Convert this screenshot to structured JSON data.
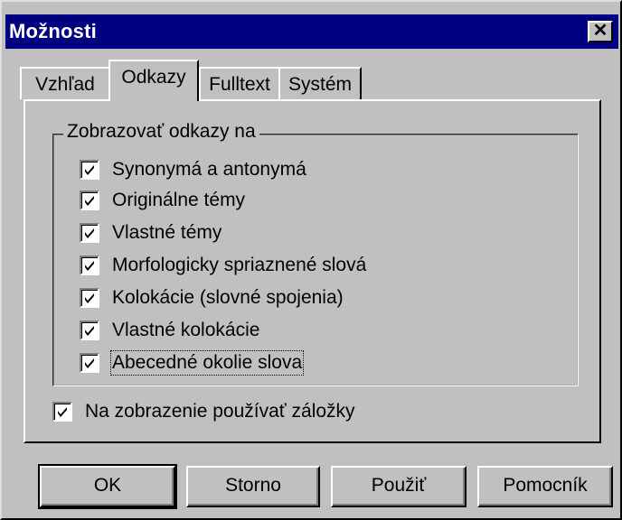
{
  "window": {
    "title": "Možnosti",
    "close_label": "✕"
  },
  "tabs": [
    {
      "label": "Vzhľad",
      "active": false
    },
    {
      "label": "Odkazy",
      "active": true
    },
    {
      "label": "Fulltext",
      "active": false
    },
    {
      "label": "Systém",
      "active": false
    }
  ],
  "group": {
    "legend": "Zobrazovať odkazy na",
    "items": [
      {
        "label": "Synonymá a antonymá",
        "checked": true
      },
      {
        "label": "Originálne témy",
        "checked": true
      },
      {
        "label": "Vlastné témy",
        "checked": true
      },
      {
        "label": "Morfologicky spriaznené slová",
        "checked": true
      },
      {
        "label": "Kolokácie (slovné spojenia)",
        "checked": true
      },
      {
        "label": "Vlastné kolokácie",
        "checked": true
      },
      {
        "label": "Abecedné okolie slova",
        "checked": true
      }
    ]
  },
  "bookmark_option": {
    "label": "Na zobrazenie používať záložky",
    "checked": true
  },
  "buttons": {
    "ok": "OK",
    "cancel": "Storno",
    "apply": "Použiť",
    "help": "Pomocník"
  },
  "colors": {
    "titlebar": "#000080",
    "face": "#c0c0c0"
  }
}
